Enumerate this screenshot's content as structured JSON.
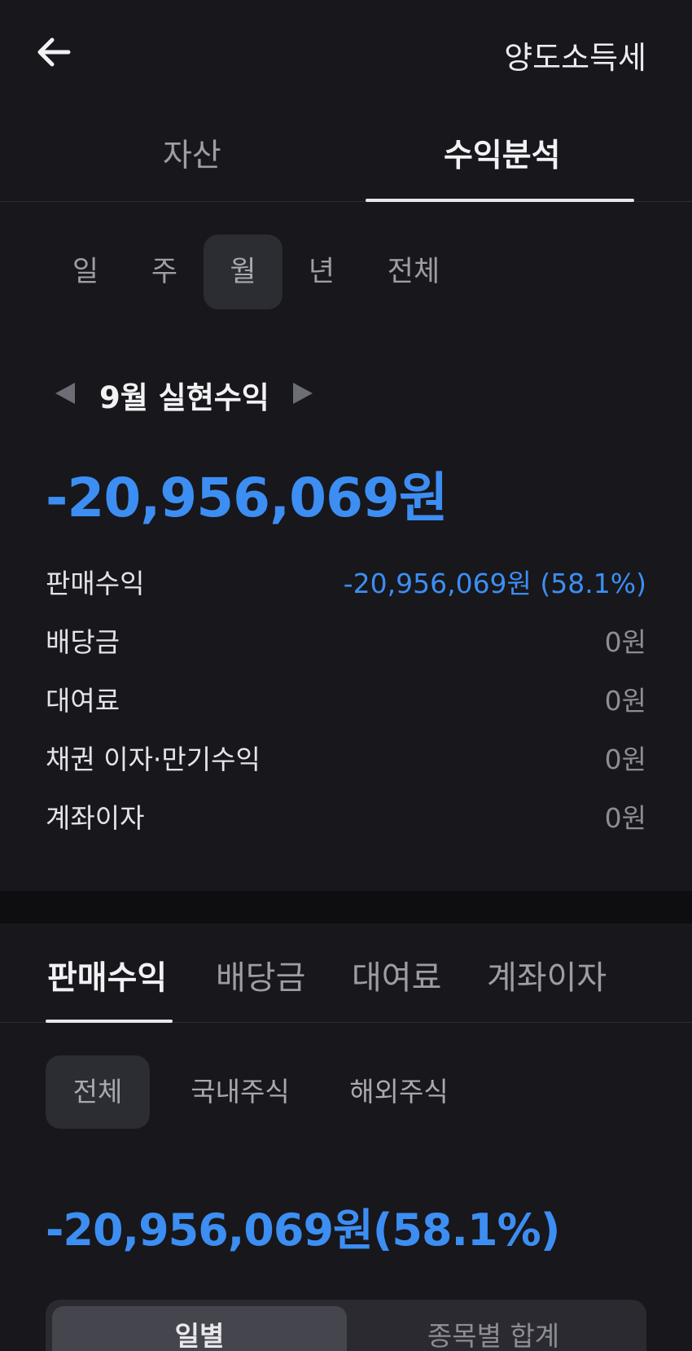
{
  "header": {
    "back_icon": "arrow-left-icon",
    "tax_label": "양도소득세"
  },
  "main_tabs": [
    {
      "label": "자산",
      "active": false
    },
    {
      "label": "수익분석",
      "active": true
    }
  ],
  "periods": [
    {
      "label": "일",
      "active": false
    },
    {
      "label": "주",
      "active": false
    },
    {
      "label": "월",
      "active": true
    },
    {
      "label": "년",
      "active": false
    },
    {
      "label": "전체",
      "active": false
    }
  ],
  "month": {
    "title": "9월 실현수익",
    "prev_icon": "triangle-left-icon",
    "next_icon": "triangle-right-icon"
  },
  "total_amount": "-20,956,069원",
  "breakdown": [
    {
      "label": "판매수익",
      "value": "-20,956,069원 (58.1%)"
    },
    {
      "label": "배당금",
      "value": "0원"
    },
    {
      "label": "대여료",
      "value": "0원"
    },
    {
      "label": "채권 이자·만기수익",
      "value": "0원"
    },
    {
      "label": "계좌이자",
      "value": "0원"
    }
  ],
  "sub_tabs": [
    {
      "label": "판매수익",
      "active": true
    },
    {
      "label": "배당금",
      "active": false
    },
    {
      "label": "대여료",
      "active": false
    },
    {
      "label": "계좌이자",
      "active": false
    }
  ],
  "markets": [
    {
      "label": "전체",
      "active": true
    },
    {
      "label": "국내주식",
      "active": false
    },
    {
      "label": "해외주식",
      "active": false
    }
  ],
  "sub_amount": "-20,956,069원(58.1%)",
  "segments": [
    {
      "label": "일별",
      "active": true
    },
    {
      "label": "종목별 합계",
      "active": false
    }
  ],
  "colors": {
    "background": "#17171c",
    "accent_blue": "#3d8ef2",
    "divider": "#0e0e11"
  }
}
